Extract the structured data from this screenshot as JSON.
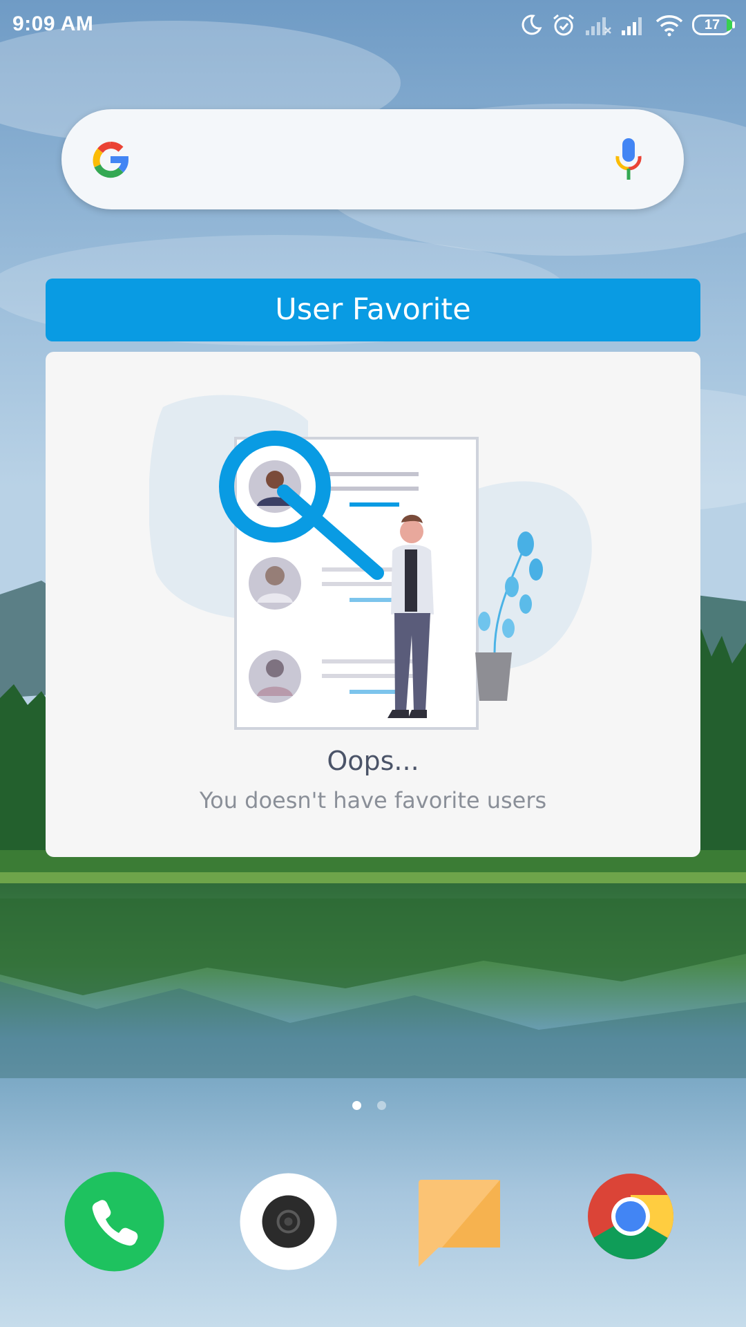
{
  "status_bar": {
    "time": "9:09 AM",
    "battery_level": "17",
    "icons": [
      "moon-icon",
      "alarm-icon",
      "signal-off-icon",
      "signal-icon",
      "wifi-icon",
      "battery-icon"
    ]
  },
  "search_widget": {
    "icons": [
      "google-logo-icon",
      "microphone-icon"
    ]
  },
  "favorite_widget": {
    "header": "User Favorite",
    "empty_title": "Oops...",
    "empty_message": "You doesn't have favorite users"
  },
  "home": {
    "pages_total": 2,
    "current_page": 1
  },
  "dock": {
    "apps": [
      {
        "icon": "phone-icon",
        "color": "#1ec25f"
      },
      {
        "icon": "camera-icon",
        "color": "#ffffff"
      },
      {
        "icon": "messages-icon",
        "color": "#f6b24f"
      },
      {
        "icon": "chrome-icon",
        "color": "#db4437"
      }
    ]
  },
  "colors": {
    "accent": "#099be3",
    "card_bg": "#f6f6f6"
  }
}
